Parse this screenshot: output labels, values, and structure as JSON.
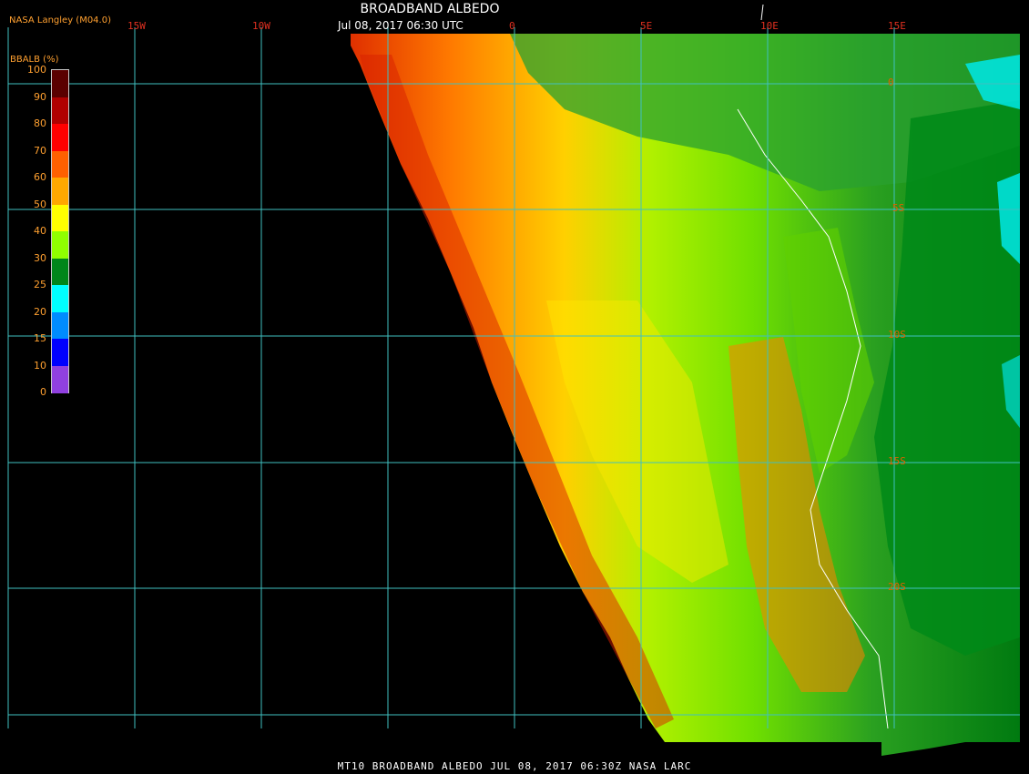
{
  "title": "BROADBAND ALBEDO",
  "subtitle": "Jul 08, 2017 06:30 UTC",
  "credit": "NASA Langley (M04.0)",
  "footer": "MT10  BROADBAND ALBEDO   JUL 08, 2017 06:30Z   NASA LARC",
  "longitude_labels": [
    "15W",
    "10W",
    "0",
    "5E",
    "10E",
    "15E"
  ],
  "latitude_labels": [
    "0",
    "5S",
    "10S",
    "15S",
    "20S"
  ],
  "legend": {
    "title": "BBALB (%)",
    "ticks": [
      "100",
      "90",
      "80",
      "70",
      "60",
      "50",
      "40",
      "30",
      "25",
      "20",
      "15",
      "10",
      "0"
    ],
    "colors": [
      "#5a0000",
      "#b00000",
      "#ff0000",
      "#ff6000",
      "#ffa800",
      "#ffff00",
      "#90ff00",
      "#00861a",
      "#00ffff",
      "#008cff",
      "#0000ff",
      "#9040e0"
    ]
  },
  "colors": {
    "grid": "#40c0c0",
    "background": "#000000"
  }
}
